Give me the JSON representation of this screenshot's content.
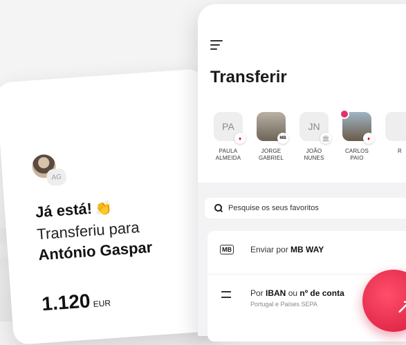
{
  "success_card": {
    "initials": "AG",
    "headline": "Já está!",
    "line2": "Transferiu para",
    "recipient": "António Gaspar",
    "amount": "1.120",
    "currency": "EUR"
  },
  "transfer": {
    "title": "Transferir",
    "contacts": [
      {
        "initials": "PA",
        "name_line1": "PAULA",
        "name_line2": "ALMEIDA",
        "bank_icon": "santander-icon"
      },
      {
        "initials": "",
        "name_line1": "JORGE",
        "name_line2": "GABRIEL",
        "bank_icon": "mb-icon",
        "badge_text": "MB"
      },
      {
        "initials": "JN",
        "name_line1": "JOÃO",
        "name_line2": "NUNES",
        "bank_icon": "bank-icon"
      },
      {
        "initials": "",
        "name_line1": "CARLOS",
        "name_line2": "PAIO",
        "bank_icon": "santander-icon"
      },
      {
        "initials": "",
        "name_line1": "R",
        "name_line2": ""
      }
    ],
    "search_placeholder": "Pesquise os seus favoritos",
    "options": [
      {
        "prefix": "Enviar por ",
        "bold": "MB WAY",
        "sub": ""
      },
      {
        "prefix": "Por ",
        "bold": "IBAN",
        "middle": " ou ",
        "bold2": "nº de conta",
        "sub": "Portugal e Países SEPA"
      }
    ],
    "mb_logo_text": "MB"
  },
  "colors": {
    "accent": "#e0284a",
    "badge_pink": "#e0316b"
  }
}
